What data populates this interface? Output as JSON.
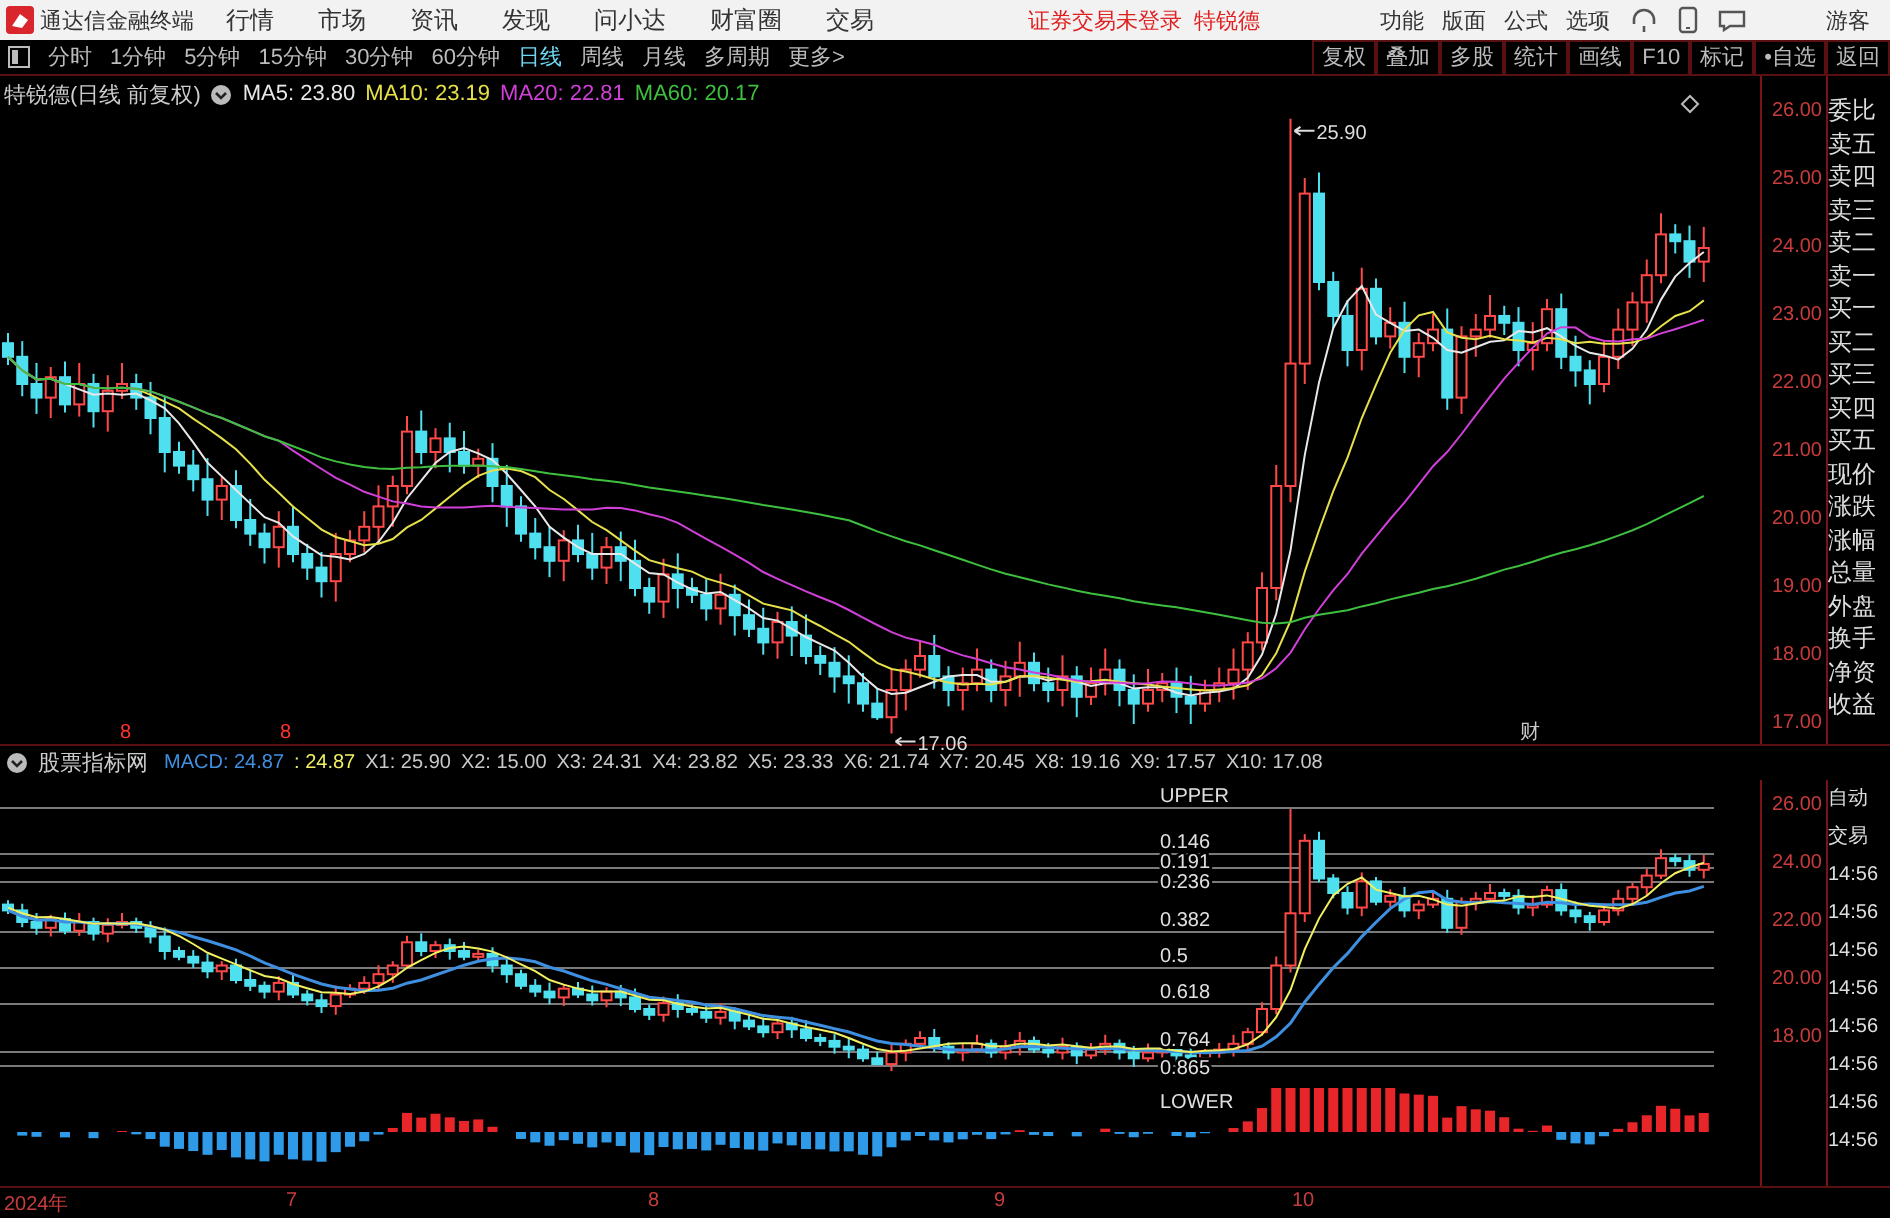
{
  "app": {
    "title": "通达信金融终端",
    "menu": [
      "行情",
      "市场",
      "资讯",
      "发现",
      "问小达",
      "财富圈",
      "交易"
    ],
    "notice": "证券交易未登录",
    "stock_link": "特锐德",
    "tools": [
      "功能",
      "版面",
      "公式",
      "选项"
    ],
    "user": "游客"
  },
  "periods": [
    {
      "label": "分时",
      "selected": false
    },
    {
      "label": "1分钟",
      "selected": false
    },
    {
      "label": "5分钟",
      "selected": false
    },
    {
      "label": "15分钟",
      "selected": false
    },
    {
      "label": "30分钟",
      "selected": false
    },
    {
      "label": "60分钟",
      "selected": false
    },
    {
      "label": "日线",
      "selected": true
    },
    {
      "label": "周线",
      "selected": false
    },
    {
      "label": "月线",
      "selected": false
    },
    {
      "label": "多周期",
      "selected": false
    },
    {
      "label": "更多>",
      "selected": false
    }
  ],
  "toolbar": [
    "复权",
    "叠加",
    "多股",
    "统计",
    "画线",
    "F10",
    "标记",
    "•自选",
    "返回"
  ],
  "legend": {
    "title": "特锐德(日线 前复权)",
    "items": [
      {
        "label": "MA5: 23.80",
        "color": "#e8e8e8"
      },
      {
        "label": "MA10: 23.19",
        "color": "#e6e04a"
      },
      {
        "label": "MA20: 22.81",
        "color": "#d040d8"
      },
      {
        "label": "MA60: 20.17",
        "color": "#3fbf3f"
      }
    ]
  },
  "annotations": [
    "25.90",
    "17.06"
  ],
  "markers": [
    {
      "text": "8",
      "color": "#ff3030"
    },
    {
      "text": "8",
      "color": "#ff3030"
    },
    {
      "text": "财",
      "color": "#c8c8c8"
    }
  ],
  "price_axis": [
    "26.00",
    "25.00",
    "24.00",
    "23.00",
    "22.00",
    "21.00",
    "20.00",
    "19.00",
    "18.00",
    "17.00"
  ],
  "quote_panel": [
    "委比",
    "卖五",
    "卖四",
    "卖三",
    "卖二",
    "卖一",
    "买一",
    "买二",
    "买三",
    "买四",
    "买五",
    "现价",
    "涨跌",
    "涨幅",
    "总量",
    "外盘",
    "换手",
    "净资",
    "收益"
  ],
  "indicator": {
    "title": "股票指标网",
    "values": [
      {
        "label": "MACD: 24.87",
        "color": "#3f8fe0"
      },
      {
        "label": ": 24.87",
        "color": "#f0f060"
      },
      {
        "label": "X1: 25.90",
        "color": "#c8c8c8"
      },
      {
        "label": "X2: 15.00",
        "color": "#c8c8c8"
      },
      {
        "label": "X3: 24.31",
        "color": "#c8c8c8"
      },
      {
        "label": "X4: 23.82",
        "color": "#c8c8c8"
      },
      {
        "label": "X5: 23.33",
        "color": "#c8c8c8"
      },
      {
        "label": "X6: 21.74",
        "color": "#c8c8c8"
      },
      {
        "label": "X7: 20.45",
        "color": "#c8c8c8"
      },
      {
        "label": "X8: 19.16",
        "color": "#c8c8c8"
      },
      {
        "label": "X9: 17.57",
        "color": "#c8c8c8"
      },
      {
        "label": "X10: 17.08",
        "color": "#c8c8c8"
      }
    ],
    "levels": [
      "UPPER",
      "0.146",
      "0.191",
      "0.236",
      "0.382",
      "0.5",
      "0.618",
      "0.764",
      "0.865",
      "LOWER"
    ],
    "axis": [
      "26.00",
      "24.00",
      "22.00",
      "20.00",
      "18.00"
    ],
    "side": [
      "自动",
      "交易",
      "14:56",
      "14:56",
      "14:56",
      "14:56",
      "14:56",
      "14:56",
      "14:56",
      "14:56"
    ]
  },
  "time_axis": [
    "2024年",
    "7",
    "8",
    "9",
    "10"
  ]
}
